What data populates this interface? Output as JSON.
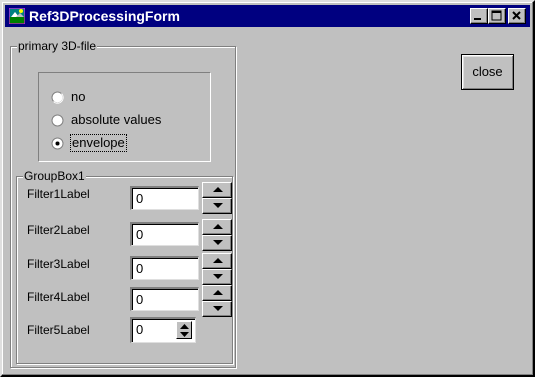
{
  "window": {
    "title": "Ref3DProcessingForm"
  },
  "titlebar_buttons": {
    "minimize_icon": "minimize-icon",
    "maximize_icon": "maximize-icon",
    "close_icon": "close-window-icon"
  },
  "primary_group": {
    "caption": "primary 3D-file",
    "options": [
      {
        "label": "no",
        "selected": false
      },
      {
        "label": "absolute values",
        "selected": false
      },
      {
        "label": "envelope",
        "selected": true
      }
    ]
  },
  "filter_group": {
    "caption": "GroupBox1",
    "filters": [
      {
        "label": "Filter1Label",
        "value": "0"
      },
      {
        "label": "Filter2Label",
        "value": "0"
      },
      {
        "label": "Filter3Label",
        "value": "0"
      },
      {
        "label": "Filter4Label",
        "value": "0"
      },
      {
        "label": "Filter5Label",
        "value": "0"
      }
    ]
  },
  "actions": {
    "close_label": "close"
  },
  "colors": {
    "titlebar": "#000080",
    "face": "#c0c0c0"
  }
}
